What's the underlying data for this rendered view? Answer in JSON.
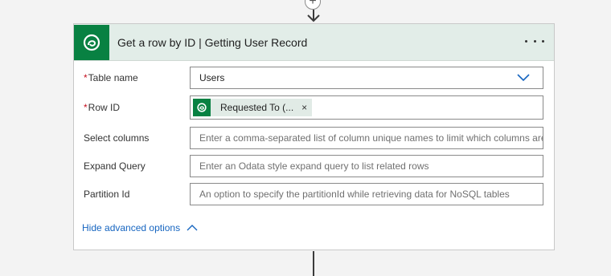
{
  "header": {
    "title": "Get a row by ID | Getting User Record",
    "app_icon": "dataverse-icon",
    "more_icon": "ellipsis-icon"
  },
  "fields": {
    "table_name": {
      "label": "Table name",
      "required": "*",
      "value": "Users",
      "icon": "chevron-down-icon"
    },
    "row_id": {
      "label": "Row ID",
      "required": "*",
      "token_label": "Requested To (...",
      "token_close": "×",
      "token_icon": "dataverse-icon"
    },
    "select_columns": {
      "label": "Select columns",
      "placeholder": "Enter a comma-separated list of column unique names to limit which columns are listed"
    },
    "expand_query": {
      "label": "Expand Query",
      "placeholder": "Enter an Odata style expand query to list related rows"
    },
    "partition_id": {
      "label": "Partition Id",
      "placeholder": "An option to specify the partitionId while retrieving data for NoSQL tables"
    }
  },
  "advanced": {
    "label": "Hide advanced options",
    "icon": "chevron-up-icon"
  },
  "connector": {
    "plus": "+",
    "plus_icon": "add-step-icon"
  },
  "colors": {
    "brand": "#088142",
    "header_bg": "#e2ede8",
    "link": "#1665c0",
    "required": "#c50f1f"
  }
}
